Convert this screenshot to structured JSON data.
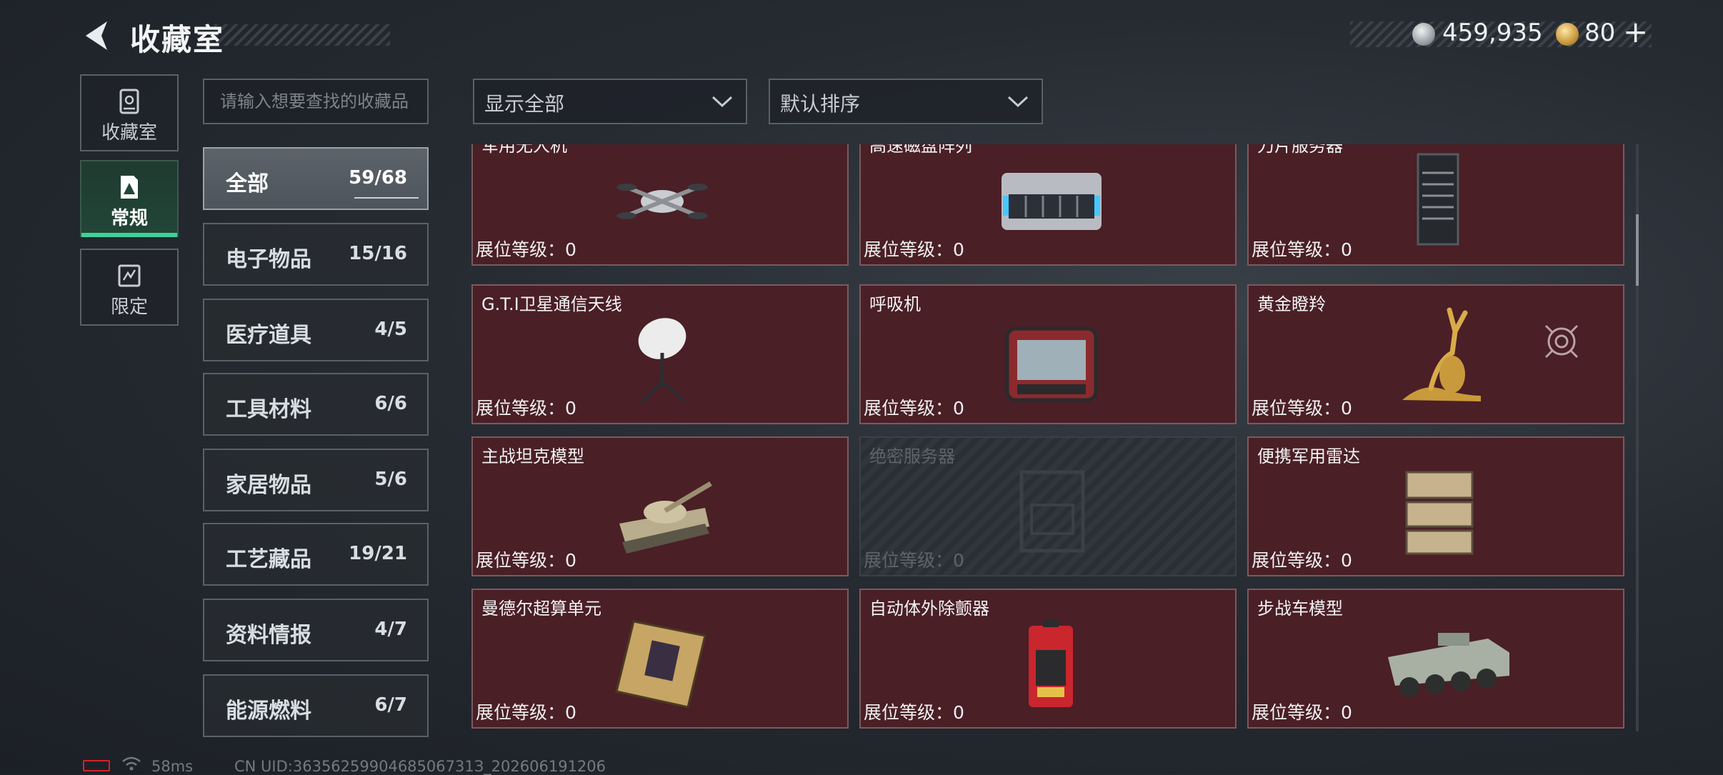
{
  "header": {
    "title": "收藏室"
  },
  "currency": {
    "silver": "459,935",
    "gold": "80",
    "plus": "+"
  },
  "nav": [
    {
      "label": "收藏室"
    },
    {
      "label": "常规"
    },
    {
      "label": "限定"
    }
  ],
  "search": {
    "placeholder": "请输入想要查找的收藏品"
  },
  "filter": {
    "display": "显示全部",
    "sort": "默认排序"
  },
  "categories": [
    {
      "name": "全部",
      "count": "59/68"
    },
    {
      "name": "电子物品",
      "count": "15/16"
    },
    {
      "name": "医疗道具",
      "count": "4/5"
    },
    {
      "name": "工具材料",
      "count": "6/6"
    },
    {
      "name": "家居物品",
      "count": "5/6"
    },
    {
      "name": "工艺藏品",
      "count": "19/21"
    },
    {
      "name": "资料情报",
      "count": "4/7"
    },
    {
      "name": "能源燃料",
      "count": "6/7"
    }
  ],
  "items": [
    {
      "name": "军用无人机",
      "level": "展位等级：0"
    },
    {
      "name": "高速磁盘阵列",
      "level": "展位等级：0"
    },
    {
      "name": "刀片服务器",
      "level": "展位等级：0"
    },
    {
      "name": "G.T.I卫星通信天线",
      "level": "展位等级：0"
    },
    {
      "name": "呼吸机",
      "level": "展位等级：0"
    },
    {
      "name": "黄金瞪羚",
      "level": "展位等级：0"
    },
    {
      "name": "主战坦克模型",
      "level": "展位等级：0"
    },
    {
      "name": "绝密服务器",
      "level": "展位等级：0"
    },
    {
      "name": "便携军用雷达",
      "level": "展位等级：0"
    },
    {
      "name": "曼德尔超算单元",
      "level": "展位等级：0"
    },
    {
      "name": "自动体外除颤器",
      "level": "展位等级：0"
    },
    {
      "name": "步战车模型",
      "level": "展位等级：0"
    }
  ],
  "footer": {
    "ping": "58ms",
    "uid": "CN UID:3635625990468506731З_202606191206"
  },
  "colors": {
    "card_bg": "#4a1f26",
    "accent": "#3fd19a",
    "battery": "#d0242a"
  }
}
